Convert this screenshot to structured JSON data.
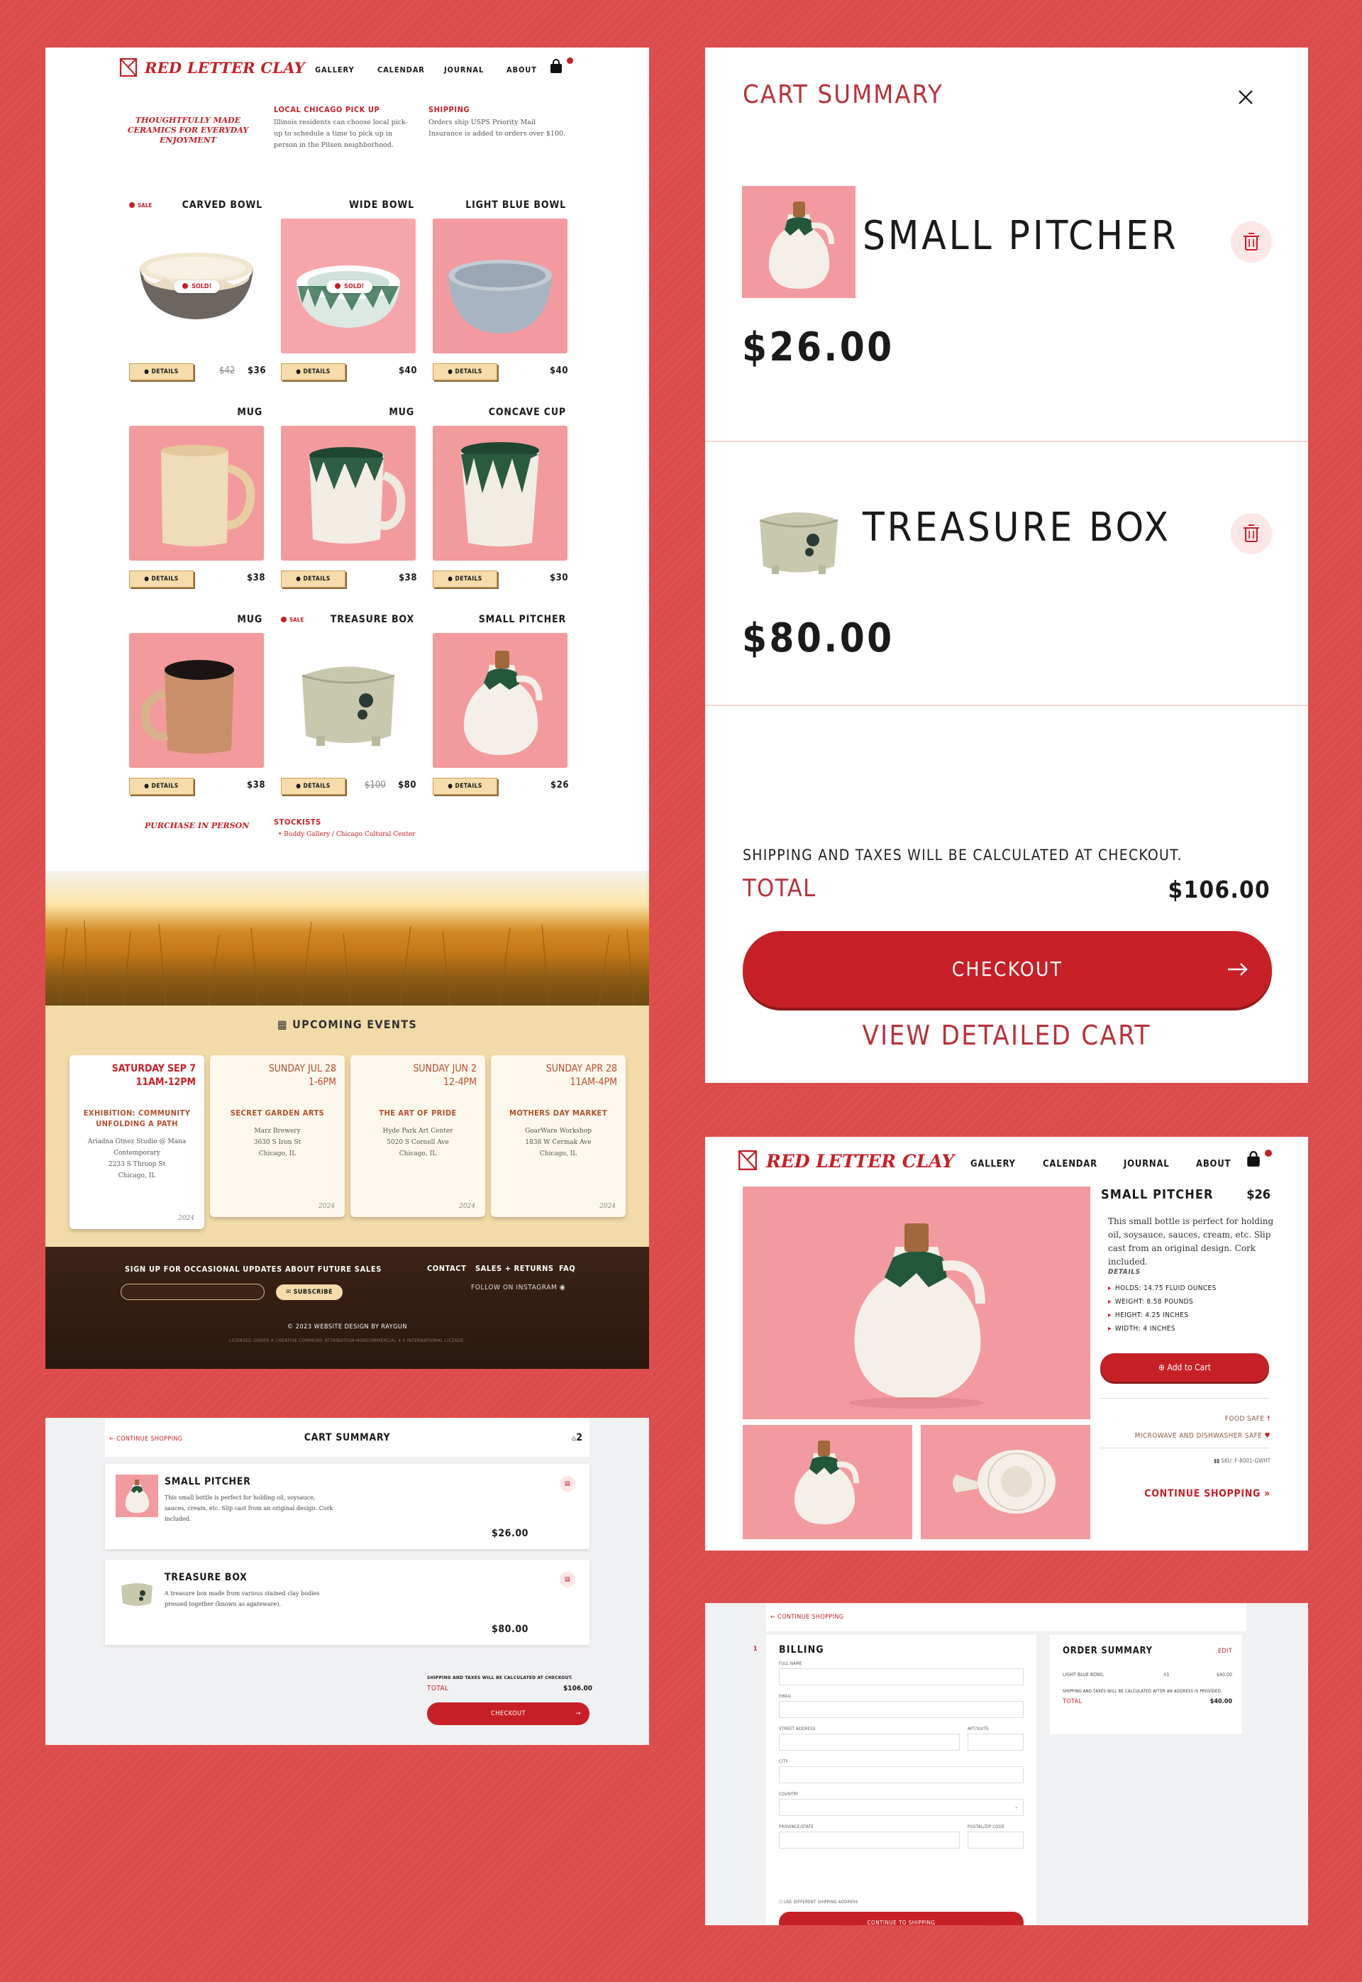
{
  "brand": {
    "name": "RED LETTER CLAY",
    "accent": "#c62026",
    "background": "#dd4c4c"
  },
  "nav": [
    "GALLERY",
    "CALENDAR",
    "JOURNAL",
    "ABOUT"
  ],
  "home": {
    "tagline": "THOUGHTFULLY MADE CERAMICS FOR EVERYDAY ENJOYMENT",
    "pickup_heading": "LOCAL CHICAGO PICK UP",
    "pickup_text": "Illinois residents can choose local pick-up to schedule a time to pick up in person in the Pilsen neighborhood.",
    "shipping_heading": "SHIPPING",
    "shipping_text": "Orders ship USPS Priority Mail Insurance is added to orders over $100.",
    "sale_label": "SALE",
    "sold_label": "SOLD!",
    "details_label": "DETAILS",
    "products": [
      {
        "name": "CARVED BOWL",
        "old_price": "$42",
        "price": "$36",
        "sale": true,
        "sold": true
      },
      {
        "name": "WIDE BOWL",
        "price": "$40",
        "sold": true
      },
      {
        "name": "LIGHT BLUE BOWL",
        "price": "$40"
      },
      {
        "name": "MUG",
        "price": "$38"
      },
      {
        "name": "MUG",
        "price": "$38"
      },
      {
        "name": "CONCAVE CUP",
        "price": "$30"
      },
      {
        "name": "MUG",
        "price": "$38"
      },
      {
        "name": "TREASURE BOX",
        "old_price": "$100",
        "price": "$80",
        "sale": true
      },
      {
        "name": "SMALL PITCHER",
        "price": "$26"
      }
    ],
    "purchase_in_person": "PURCHASE IN PERSON",
    "stockists_heading": "STOCKISTS",
    "stockists_item": "Buddy Gallery / Chicago Cultural Center",
    "events_heading": "UPCOMING EVENTS",
    "events": [
      {
        "day": "SATURDAY",
        "date": "SEP 7",
        "time": "11AM-12PM",
        "title": "EXHIBITION: COMMUNITY UNFOLDING A PATH",
        "venue": "Ariadna Gtnez Studio @ Mana Contemporary",
        "street": "2233 S Throop St",
        "city": "Chicago, IL",
        "year": "2024"
      },
      {
        "day": "SUNDAY",
        "date": "JUL 28",
        "time": "1-6PM",
        "title": "SECRET GARDEN ARTS",
        "venue": "Marz Brewery",
        "street": "3630 S Iron St",
        "city": "Chicago, IL",
        "year": "2024"
      },
      {
        "day": "SUNDAY",
        "date": "JUN 2",
        "time": "12-4PM",
        "title": "THE ART OF PRIDE",
        "venue": "Hyde Park Art Center",
        "street": "5020 S Cornell Ave",
        "city": "Chicago, IL",
        "year": "2024"
      },
      {
        "day": "SUNDAY",
        "date": "APR 28",
        "time": "11AM-4PM",
        "title": "MOTHERS DAY MARKET",
        "venue": "GoarWare Workshop",
        "street": "1838 W Cermak Ave",
        "city": "Chicago, IL",
        "year": "2024"
      }
    ],
    "footer": {
      "signup": "SIGN UP FOR OCCASIONAL UPDATES ABOUT FUTURE SALES",
      "subscribe": "SUBSCRIBE",
      "links": [
        "CONTACT",
        "SALES + RETURNS",
        "FAQ"
      ],
      "instagram": "FOLLOW ON INSTAGRAM",
      "copyright": "© 2023 WEBSITE DESIGN BY RAYGUN",
      "license": "LICENSED UNDER A CREATIVE COMMONS ATTRIBUTION-NONCOMMERCIAL 4.0 INTERNATIONAL LICENSE."
    }
  },
  "cart_drawer": {
    "title": "CART SUMMARY",
    "items": [
      {
        "name": "SMALL PITCHER",
        "price": "$26.00"
      },
      {
        "name": "TREASURE BOX",
        "price": "$80.00"
      }
    ],
    "shipping_note": "SHIPPING AND TAXES WILL BE CALCULATED AT CHECKOUT.",
    "total_label": "TOTAL",
    "total": "$106.00",
    "checkout": "CHECKOUT",
    "view_cart": "VIEW DETAILED CART"
  },
  "product_page": {
    "name": "SMALL PITCHER",
    "price": "$26",
    "description": "This small bottle is perfect for holding oil, soysauce, sauces, cream, etc. Slip cast from an original design. Cork included.",
    "details_heading": "DETAILS",
    "details": [
      "HOLDS: 14.75 FLUID OUNCES",
      "WEIGHT: 8.58 POUNDS",
      "HEIGHT: 4.25 INCHES",
      "WIDTH: 4 INCHES"
    ],
    "add_to_cart": "Add to Cart",
    "food_safe": "FOOD SAFE",
    "microwave": "MICROWAVE AND DISHWASHER SAFE",
    "sku": "SKU: F-8001-GWHT",
    "continue": "CONTINUE SHOPPING"
  },
  "cart_page": {
    "back": "← CONTINUE SHOPPING",
    "title": "CART SUMMARY",
    "count": "2",
    "items": [
      {
        "name": "SMALL PITCHER",
        "desc": "This small bottle is perfect for holding oil, soysauce, sauces, cream, etc. Slip cast from an original design. Cork included.",
        "price": "$26.00"
      },
      {
        "name": "TREASURE BOX",
        "desc": "A treasure box made from various stained clay bodies pressed together (known as agateware).",
        "price": "$80.00"
      }
    ],
    "shipping_note": "SHIPPING AND TAXES WILL BE CALCULATED AT CHECKOUT.",
    "total_label": "TOTAL",
    "total": "$106.00",
    "checkout": "CHECKOUT"
  },
  "checkout_page": {
    "back": "← CONTINUE SHOPPING",
    "step": "1",
    "billing": "BILLING",
    "labels": {
      "full_name": "FULL NAME",
      "email": "EMAIL",
      "street": "STREET ADDRESS",
      "apt": "APT/SUITE",
      "city": "CITY",
      "country": "COUNTRY",
      "province": "PROVINCE/STATE",
      "postal": "POSTAL/ZIP CODE"
    },
    "diff_ship": "USE DIFFERENT SHIPPING ADDRESS",
    "continue_btn": "CONTINUE TO SHIPPING",
    "summary_title": "ORDER SUMMARY",
    "edit": "EDIT",
    "line_item": "LIGHT BLUE BOWL",
    "line_qty": "X1",
    "line_price": "$40.00",
    "note": "SHIPPING AND TAXES WILL BE CALCULATED AFTER AN ADDRESS IS PROVIDED.",
    "total_label": "TOTAL",
    "total": "$40.00"
  }
}
